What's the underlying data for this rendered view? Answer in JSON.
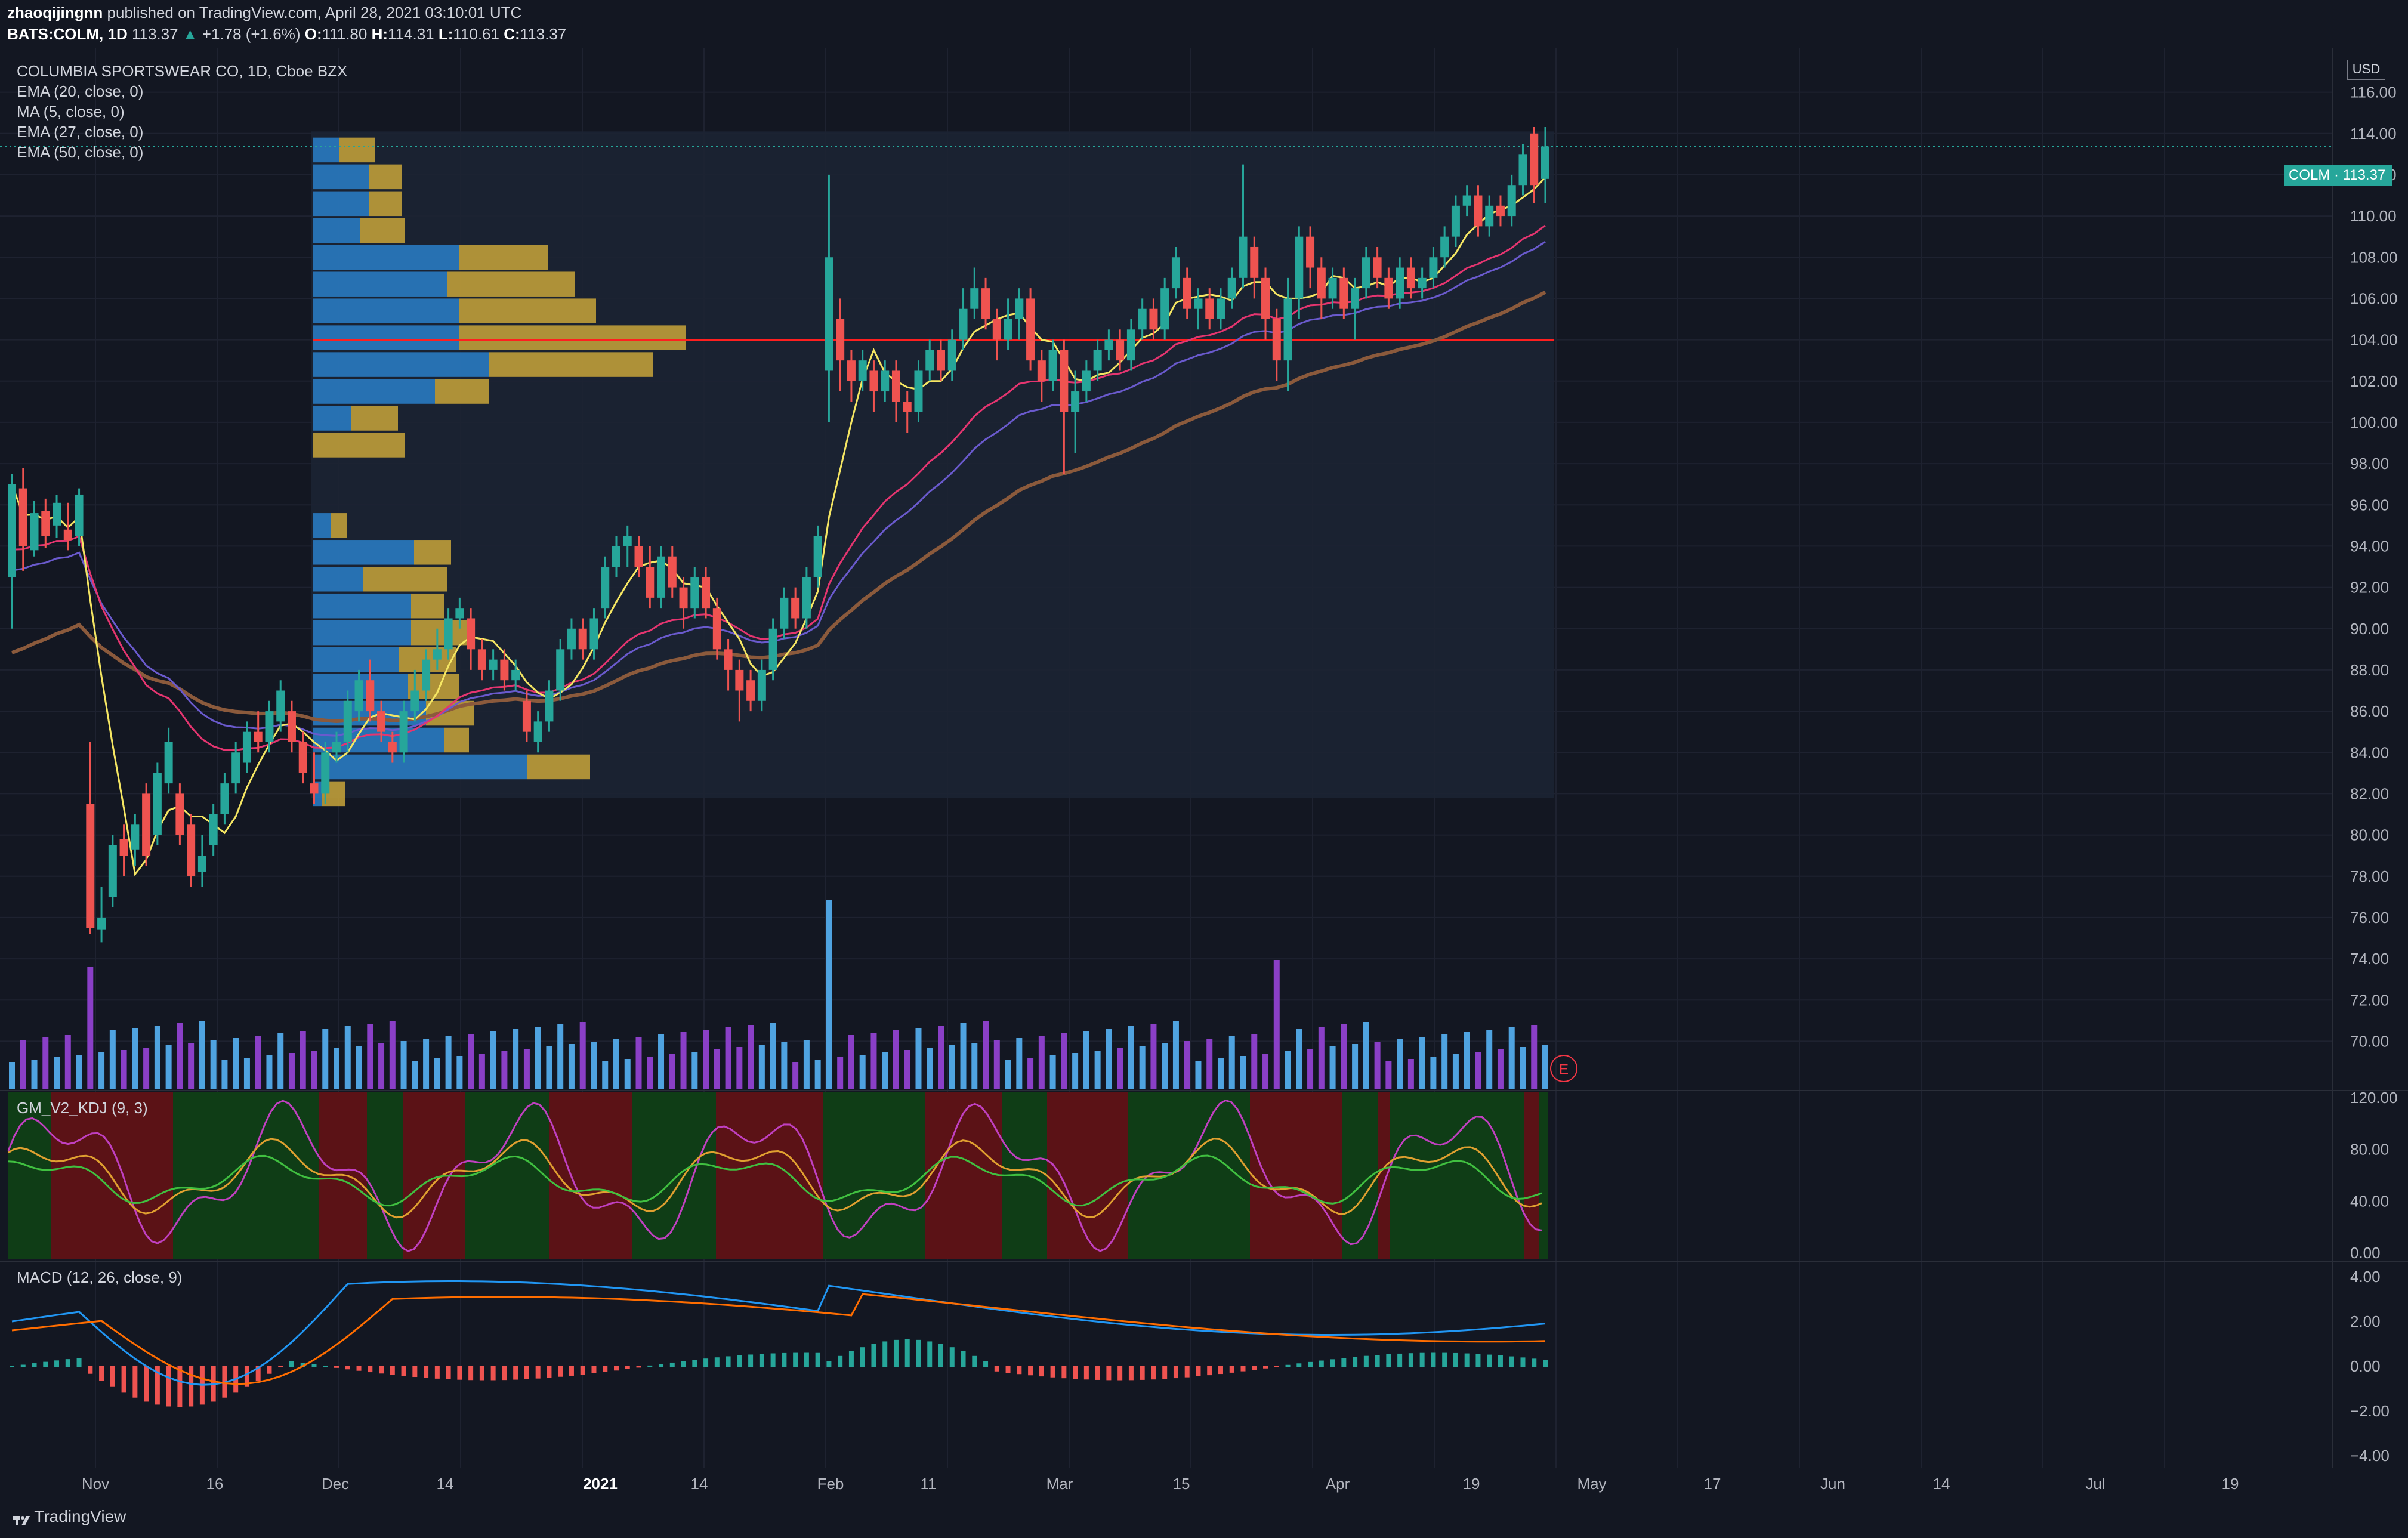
{
  "header": {
    "publisher": "zhaoqijingnn",
    "published_text": "published on TradingView.com, April 28, 2021 03:10:01 UTC",
    "symbol": "BATS:COLM, 1D",
    "last": "113.37",
    "change": "+1.78 (+1.6%)",
    "o_label": "O:",
    "o": "111.80",
    "h_label": "H:",
    "h": "114.31",
    "l_label": "L:",
    "l": "110.61",
    "c_label": "C:",
    "c": "113.37"
  },
  "legend": {
    "title": "COLUMBIA SPORTSWEAR CO, 1D, Cboe BZX",
    "ema20": "EMA (20, close, 0)",
    "ma5": "MA (5, close, 0)",
    "ema27": "EMA (27, close, 0)",
    "ema50": "EMA (50, close, 0)"
  },
  "price_axis": {
    "currency": "USD",
    "labels": [
      "116.00",
      "114.00",
      "112.00",
      "110.00",
      "108.00",
      "106.00",
      "104.00",
      "102.00",
      "100.00",
      "98.00",
      "96.00",
      "94.00",
      "92.00",
      "90.00",
      "88.00",
      "86.00",
      "84.00",
      "82.00",
      "80.00",
      "78.00",
      "76.00",
      "74.00",
      "72.00",
      "70.00"
    ],
    "last_price_label": "COLM · 113.37"
  },
  "kdj": {
    "label": "GM_V2_KDJ (9, 3)",
    "axis": [
      "120.00",
      "80.00",
      "40.00",
      "0.00"
    ]
  },
  "macd": {
    "label": "MACD (12, 26, close, 9)",
    "axis": [
      "4.00",
      "2.00",
      "0.00",
      "−2.00",
      "−4.00"
    ]
  },
  "time_axis": [
    "Nov",
    "16",
    "Dec",
    "14",
    "2021",
    "14",
    "Feb",
    "11",
    "Mar",
    "15",
    "Apr",
    "19",
    "May",
    "17",
    "Jun",
    "14",
    "Jul",
    "19"
  ],
  "earnings_marker": "E",
  "footer": {
    "brand": "TradingView"
  },
  "colors": {
    "background": "#131722",
    "up": "#26a69a",
    "down": "#ef5350",
    "support_line": "#ff1f1f",
    "ma5": "#f5e663",
    "ema20": "#e53570",
    "ema27": "#6a5acd",
    "ema50": "#8b5a3c",
    "vp_buy": "#2a7fc9",
    "vp_sell": "#c9a53a"
  },
  "chart_data": {
    "type": "candlestick",
    "title": "COLUMBIA SPORTSWEAR CO, 1D, Cboe BZX",
    "y_range": [
      69,
      117
    ],
    "support_level": 104.0,
    "candles": [
      {
        "o": 92.5,
        "c": 97.0,
        "h": 97.5,
        "l": 90.0
      },
      {
        "o": 96.8,
        "c": 94.0,
        "h": 97.8,
        "l": 92.8
      },
      {
        "o": 93.8,
        "c": 95.6,
        "h": 96.2,
        "l": 93.5
      },
      {
        "o": 95.7,
        "c": 94.5,
        "h": 96.3,
        "l": 93.9
      },
      {
        "o": 95.0,
        "c": 96.1,
        "h": 96.5,
        "l": 94.4
      },
      {
        "o": 94.8,
        "c": 94.3,
        "h": 96.1,
        "l": 93.8
      },
      {
        "o": 94.5,
        "c": 96.5,
        "h": 96.8,
        "l": 94.0
      },
      {
        "o": 81.5,
        "c": 75.5,
        "h": 84.5,
        "l": 75.2
      },
      {
        "o": 75.4,
        "c": 76.0,
        "h": 77.5,
        "l": 74.8
      },
      {
        "o": 77.0,
        "c": 79.5,
        "h": 80.0,
        "l": 76.5
      },
      {
        "o": 79.8,
        "c": 79.0,
        "h": 80.5,
        "l": 78.0
      },
      {
        "o": 79.3,
        "c": 80.5,
        "h": 81.0,
        "l": 78.5
      },
      {
        "o": 82.0,
        "c": 79.0,
        "h": 82.5,
        "l": 78.5
      },
      {
        "o": 80.0,
        "c": 83.0,
        "h": 83.5,
        "l": 79.5
      },
      {
        "o": 82.5,
        "c": 84.5,
        "h": 85.2,
        "l": 82.0
      },
      {
        "o": 82.0,
        "c": 80.0,
        "h": 82.5,
        "l": 79.5
      },
      {
        "o": 80.5,
        "c": 78.0,
        "h": 81.0,
        "l": 77.5
      },
      {
        "o": 78.2,
        "c": 79.0,
        "h": 80.0,
        "l": 77.5
      },
      {
        "o": 79.5,
        "c": 81.0,
        "h": 81.5,
        "l": 79.0
      },
      {
        "o": 81.0,
        "c": 82.5,
        "h": 83.0,
        "l": 80.5
      },
      {
        "o": 82.5,
        "c": 84.0,
        "h": 84.5,
        "l": 82.0
      },
      {
        "o": 83.5,
        "c": 85.0,
        "h": 85.5,
        "l": 83.0
      },
      {
        "o": 85.0,
        "c": 84.5,
        "h": 86.0,
        "l": 84.0
      },
      {
        "o": 84.5,
        "c": 86.0,
        "h": 86.5,
        "l": 84.0
      },
      {
        "o": 85.5,
        "c": 87.0,
        "h": 87.5,
        "l": 85.0
      },
      {
        "o": 86.0,
        "c": 84.5,
        "h": 86.5,
        "l": 84.0
      },
      {
        "o": 84.5,
        "c": 83.0,
        "h": 85.0,
        "l": 82.5
      },
      {
        "o": 82.5,
        "c": 82.0,
        "h": 84.0,
        "l": 81.5
      },
      {
        "o": 82.0,
        "c": 84.0,
        "h": 84.5,
        "l": 81.5
      },
      {
        "o": 84.0,
        "c": 84.5,
        "h": 85.0,
        "l": 83.5
      },
      {
        "o": 84.5,
        "c": 86.5,
        "h": 87.0,
        "l": 84.0
      },
      {
        "o": 86.0,
        "c": 87.5,
        "h": 88.0,
        "l": 85.5
      },
      {
        "o": 87.5,
        "c": 86.0,
        "h": 88.5,
        "l": 85.5
      },
      {
        "o": 86.0,
        "c": 85.0,
        "h": 86.5,
        "l": 84.5
      },
      {
        "o": 84.5,
        "c": 84.0,
        "h": 85.0,
        "l": 83.5
      },
      {
        "o": 84.0,
        "c": 86.0,
        "h": 86.5,
        "l": 83.5
      },
      {
        "o": 86.0,
        "c": 87.0,
        "h": 88.0,
        "l": 85.5
      },
      {
        "o": 87.0,
        "c": 88.5,
        "h": 89.0,
        "l": 86.5
      },
      {
        "o": 88.5,
        "c": 89.0,
        "h": 90.0,
        "l": 88.0
      },
      {
        "o": 89.0,
        "c": 90.5,
        "h": 91.0,
        "l": 88.5
      },
      {
        "o": 90.5,
        "c": 91.0,
        "h": 91.5,
        "l": 90.0
      },
      {
        "o": 90.5,
        "c": 89.0,
        "h": 91.0,
        "l": 88.0
      },
      {
        "o": 89.0,
        "c": 88.0,
        "h": 89.5,
        "l": 87.5
      },
      {
        "o": 88.0,
        "c": 88.5,
        "h": 89.0,
        "l": 87.5
      },
      {
        "o": 88.5,
        "c": 87.5,
        "h": 89.0,
        "l": 87.0
      },
      {
        "o": 87.5,
        "c": 88.0,
        "h": 88.5,
        "l": 87.0
      },
      {
        "o": 86.5,
        "c": 85.0,
        "h": 87.0,
        "l": 84.5
      },
      {
        "o": 84.5,
        "c": 85.5,
        "h": 86.0,
        "l": 84.0
      },
      {
        "o": 85.5,
        "c": 87.0,
        "h": 87.5,
        "l": 85.0
      },
      {
        "o": 87.0,
        "c": 89.0,
        "h": 89.5,
        "l": 86.5
      },
      {
        "o": 89.0,
        "c": 90.0,
        "h": 90.5,
        "l": 88.5
      },
      {
        "o": 90.0,
        "c": 89.0,
        "h": 90.5,
        "l": 88.5
      },
      {
        "o": 89.0,
        "c": 90.5,
        "h": 91.0,
        "l": 88.5
      },
      {
        "o": 91.0,
        "c": 93.0,
        "h": 93.5,
        "l": 90.5
      },
      {
        "o": 93.0,
        "c": 94.0,
        "h": 94.5,
        "l": 92.5
      },
      {
        "o": 94.0,
        "c": 94.5,
        "h": 95.0,
        "l": 93.0
      },
      {
        "o": 94.0,
        "c": 93.0,
        "h": 94.5,
        "l": 92.5
      },
      {
        "o": 93.0,
        "c": 91.5,
        "h": 94.0,
        "l": 91.0
      },
      {
        "o": 91.5,
        "c": 93.5,
        "h": 94.0,
        "l": 91.0
      },
      {
        "o": 93.5,
        "c": 92.0,
        "h": 94.0,
        "l": 91.5
      },
      {
        "o": 92.0,
        "c": 91.0,
        "h": 92.5,
        "l": 90.0
      },
      {
        "o": 91.0,
        "c": 92.5,
        "h": 93.0,
        "l": 90.5
      },
      {
        "o": 92.5,
        "c": 91.0,
        "h": 93.0,
        "l": 90.5
      },
      {
        "o": 91.0,
        "c": 89.0,
        "h": 91.5,
        "l": 88.5
      },
      {
        "o": 89.0,
        "c": 88.0,
        "h": 89.5,
        "l": 87.0
      },
      {
        "o": 88.0,
        "c": 87.0,
        "h": 88.5,
        "l": 85.5
      },
      {
        "o": 87.5,
        "c": 86.5,
        "h": 88.0,
        "l": 86.0
      },
      {
        "o": 86.5,
        "c": 88.0,
        "h": 88.5,
        "l": 86.0
      },
      {
        "o": 88.0,
        "c": 90.0,
        "h": 90.5,
        "l": 87.5
      },
      {
        "o": 90.0,
        "c": 91.5,
        "h": 92.0,
        "l": 89.5
      },
      {
        "o": 91.5,
        "c": 90.5,
        "h": 92.0,
        "l": 90.0
      },
      {
        "o": 90.5,
        "c": 92.5,
        "h": 93.0,
        "l": 90.0
      },
      {
        "o": 92.5,
        "c": 94.5,
        "h": 95.0,
        "l": 92.0
      },
      {
        "o": 102.5,
        "c": 108.0,
        "h": 112.0,
        "l": 100.0
      },
      {
        "o": 105.0,
        "c": 103.0,
        "h": 106.0,
        "l": 101.5
      },
      {
        "o": 103.0,
        "c": 102.0,
        "h": 103.5,
        "l": 101.0
      },
      {
        "o": 102.0,
        "c": 103.0,
        "h": 103.5,
        "l": 101.5
      },
      {
        "o": 102.5,
        "c": 101.5,
        "h": 103.0,
        "l": 100.5
      },
      {
        "o": 101.5,
        "c": 102.5,
        "h": 103.0,
        "l": 101.0
      },
      {
        "o": 102.5,
        "c": 101.0,
        "h": 103.0,
        "l": 100.0
      },
      {
        "o": 101.0,
        "c": 100.5,
        "h": 101.5,
        "l": 99.5
      },
      {
        "o": 100.5,
        "c": 102.5,
        "h": 103.0,
        "l": 100.0
      },
      {
        "o": 102.5,
        "c": 103.5,
        "h": 104.0,
        "l": 102.0
      },
      {
        "o": 103.5,
        "c": 102.5,
        "h": 104.0,
        "l": 102.0
      },
      {
        "o": 102.5,
        "c": 104.0,
        "h": 104.5,
        "l": 102.0
      },
      {
        "o": 104.0,
        "c": 105.5,
        "h": 106.5,
        "l": 103.5
      },
      {
        "o": 105.5,
        "c": 106.5,
        "h": 107.5,
        "l": 105.0
      },
      {
        "o": 106.5,
        "c": 105.0,
        "h": 107.0,
        "l": 104.5
      },
      {
        "o": 105.0,
        "c": 104.0,
        "h": 105.5,
        "l": 103.0
      },
      {
        "o": 104.0,
        "c": 105.0,
        "h": 106.0,
        "l": 103.5
      },
      {
        "o": 105.0,
        "c": 106.0,
        "h": 106.5,
        "l": 104.0
      },
      {
        "o": 106.0,
        "c": 103.0,
        "h": 106.5,
        "l": 102.5
      },
      {
        "o": 103.0,
        "c": 102.0,
        "h": 103.5,
        "l": 101.0
      },
      {
        "o": 102.0,
        "c": 103.5,
        "h": 104.0,
        "l": 101.5
      },
      {
        "o": 103.5,
        "c": 100.5,
        "h": 104.0,
        "l": 97.5
      },
      {
        "o": 100.5,
        "c": 101.5,
        "h": 102.5,
        "l": 98.5
      },
      {
        "o": 101.5,
        "c": 102.5,
        "h": 103.0,
        "l": 101.0
      },
      {
        "o": 102.5,
        "c": 103.5,
        "h": 104.0,
        "l": 102.0
      },
      {
        "o": 103.5,
        "c": 104.0,
        "h": 104.5,
        "l": 103.0
      },
      {
        "o": 104.0,
        "c": 103.0,
        "h": 104.5,
        "l": 102.5
      },
      {
        "o": 103.0,
        "c": 104.5,
        "h": 105.0,
        "l": 102.5
      },
      {
        "o": 104.5,
        "c": 105.5,
        "h": 106.0,
        "l": 104.0
      },
      {
        "o": 105.5,
        "c": 104.5,
        "h": 106.0,
        "l": 104.0
      },
      {
        "o": 104.5,
        "c": 106.5,
        "h": 107.0,
        "l": 104.0
      },
      {
        "o": 106.5,
        "c": 108.0,
        "h": 108.5,
        "l": 106.0
      },
      {
        "o": 107.0,
        "c": 105.5,
        "h": 107.5,
        "l": 105.0
      },
      {
        "o": 105.5,
        "c": 106.0,
        "h": 106.5,
        "l": 104.5
      },
      {
        "o": 106.0,
        "c": 105.0,
        "h": 106.5,
        "l": 104.5
      },
      {
        "o": 105.0,
        "c": 106.0,
        "h": 106.5,
        "l": 104.5
      },
      {
        "o": 106.0,
        "c": 107.0,
        "h": 107.5,
        "l": 105.5
      },
      {
        "o": 107.0,
        "c": 109.0,
        "h": 112.5,
        "l": 106.5
      },
      {
        "o": 108.5,
        "c": 107.0,
        "h": 109.0,
        "l": 106.0
      },
      {
        "o": 107.0,
        "c": 105.0,
        "h": 107.5,
        "l": 104.0
      },
      {
        "o": 105.0,
        "c": 103.0,
        "h": 105.5,
        "l": 102.0
      },
      {
        "o": 103.0,
        "c": 106.0,
        "h": 107.0,
        "l": 101.5
      },
      {
        "o": 106.0,
        "c": 109.0,
        "h": 109.5,
        "l": 105.0
      },
      {
        "o": 109.0,
        "c": 107.5,
        "h": 109.5,
        "l": 106.5
      },
      {
        "o": 107.5,
        "c": 106.0,
        "h": 108.0,
        "l": 105.0
      },
      {
        "o": 106.0,
        "c": 107.0,
        "h": 107.5,
        "l": 105.5
      },
      {
        "o": 107.0,
        "c": 105.5,
        "h": 107.5,
        "l": 105.0
      },
      {
        "o": 105.5,
        "c": 106.5,
        "h": 107.0,
        "l": 104.0
      },
      {
        "o": 106.5,
        "c": 108.0,
        "h": 108.5,
        "l": 106.0
      },
      {
        "o": 108.0,
        "c": 107.0,
        "h": 108.5,
        "l": 106.5
      },
      {
        "o": 107.0,
        "c": 106.0,
        "h": 107.5,
        "l": 105.5
      },
      {
        "o": 106.0,
        "c": 107.5,
        "h": 108.0,
        "l": 105.5
      },
      {
        "o": 107.5,
        "c": 106.5,
        "h": 108.0,
        "l": 106.0
      },
      {
        "o": 106.5,
        "c": 107.0,
        "h": 107.5,
        "l": 106.0
      },
      {
        "o": 107.0,
        "c": 108.0,
        "h": 108.5,
        "l": 106.5
      },
      {
        "o": 108.0,
        "c": 109.0,
        "h": 109.5,
        "l": 107.5
      },
      {
        "o": 109.0,
        "c": 110.5,
        "h": 111.0,
        "l": 108.5
      },
      {
        "o": 110.5,
        "c": 111.0,
        "h": 111.5,
        "l": 110.0
      },
      {
        "o": 111.0,
        "c": 109.5,
        "h": 111.5,
        "l": 109.0
      },
      {
        "o": 109.5,
        "c": 110.5,
        "h": 111.0,
        "l": 109.0
      },
      {
        "o": 110.5,
        "c": 110.0,
        "h": 111.0,
        "l": 109.5
      },
      {
        "o": 110.0,
        "c": 111.5,
        "h": 112.0,
        "l": 109.5
      },
      {
        "o": 111.5,
        "c": 113.0,
        "h": 113.5,
        "l": 111.0
      },
      {
        "o": 114.0,
        "c": 111.5,
        "h": 114.31,
        "l": 110.61
      },
      {
        "o": 111.8,
        "c": 113.37,
        "h": 114.31,
        "l": 110.61
      }
    ]
  }
}
